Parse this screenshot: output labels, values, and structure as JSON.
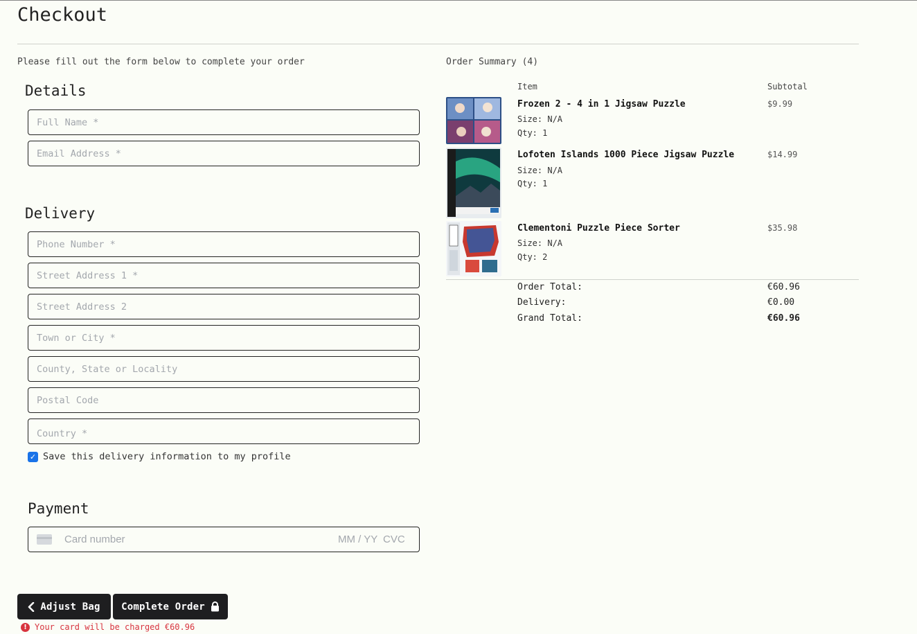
{
  "page": {
    "title": "Checkout",
    "intro": "Please fill out the form below to complete your order"
  },
  "details": {
    "heading": "Details",
    "full_name_placeholder": "Full Name *",
    "email_placeholder": "Email Address *"
  },
  "delivery": {
    "heading": "Delivery",
    "phone_placeholder": "Phone Number *",
    "street1_placeholder": "Street Address 1 *",
    "street2_placeholder": "Street Address 2",
    "town_placeholder": "Town or City *",
    "county_placeholder": "County, State or Locality",
    "postcode_placeholder": "Postal Code",
    "country_placeholder": "Country *",
    "save_info_label": "Save this delivery information to my profile",
    "save_info_checked": true
  },
  "payment": {
    "heading": "Payment",
    "card_placeholder": "Card number",
    "expiry_placeholder": "MM / YY",
    "cvc_placeholder": "CVC",
    "card_icon": "credit-card-icon"
  },
  "actions": {
    "adjust_bag_label": "Adjust Bag",
    "adjust_bag_icon": "chevron-left-icon",
    "complete_order_label": "Complete Order",
    "complete_order_icon": "lock-icon",
    "charge_message": "Your card will be charged €60.96",
    "charge_icon": "error-icon",
    "charge_color": "#d8343f"
  },
  "summary": {
    "title": "Order Summary (4)",
    "col_item": "Item",
    "col_subtotal": "Subtotal",
    "items": [
      {
        "name": "Frozen 2 - 4 in 1 Jigsaw Puzzle",
        "size": "Size: N/A",
        "qty": "Qty: 1",
        "price": "$9.99"
      },
      {
        "name": "Lofoten Islands 1000 Piece Jigsaw Puzzle",
        "size": "Size: N/A",
        "qty": "Qty: 1",
        "price": "$14.99"
      },
      {
        "name": "Clementoni Puzzle Piece Sorter",
        "size": "Size: N/A",
        "qty": "Qty: 2",
        "price": "$35.98"
      }
    ],
    "order_total_label": "Order Total:",
    "order_total": "€60.96",
    "delivery_label": "Delivery:",
    "delivery": "€0.00",
    "grand_total_label": "Grand Total:",
    "grand_total": "€60.96"
  }
}
